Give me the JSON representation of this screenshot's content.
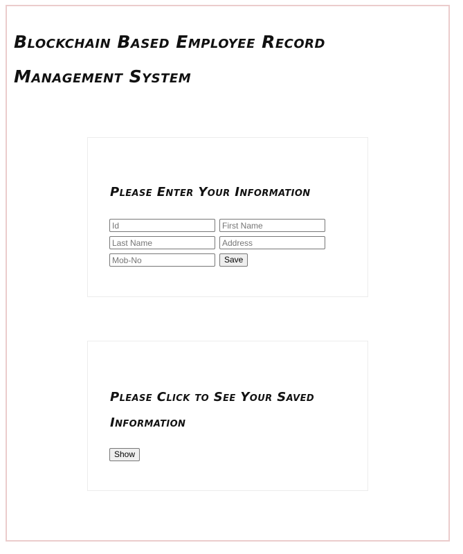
{
  "page": {
    "title": "Blockchain Based Employee Record Management System"
  },
  "form_card": {
    "heading": "Please Enter Your Information",
    "fields": {
      "id": {
        "placeholder": "Id",
        "value": ""
      },
      "first_name": {
        "placeholder": "First Name",
        "value": ""
      },
      "last_name": {
        "placeholder": "Last Name",
        "value": ""
      },
      "address": {
        "placeholder": "Address",
        "value": ""
      },
      "mobile": {
        "placeholder": "Mob-No",
        "value": ""
      }
    },
    "save_label": "Save"
  },
  "show_card": {
    "heading": "Please Click to See Your Saved Information",
    "show_label": "Show"
  },
  "colors": {
    "frame_border": "#ebcccc",
    "card_border": "#ececec",
    "text": "#111111"
  }
}
